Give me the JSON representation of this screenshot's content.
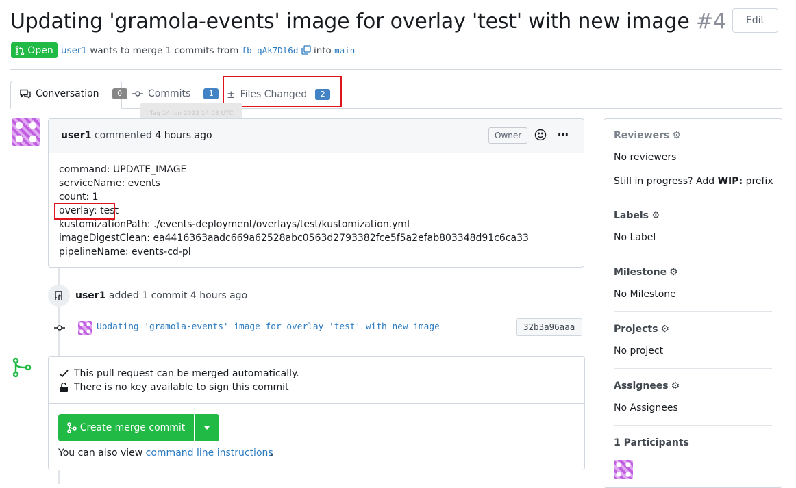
{
  "header": {
    "title": "Updating 'gramola-events' image for overlay 'test' with new image",
    "number": "#4",
    "edit_label": "Edit",
    "status": "Open",
    "author": "user1",
    "merge_text": "wants to merge 1 commits from",
    "head_branch": "fb-qAk7Dl6d",
    "into_text": "into",
    "base_branch": "main"
  },
  "tabs": [
    {
      "label": "Conversation",
      "count": "0"
    },
    {
      "label": "Commits",
      "count": "1"
    },
    {
      "label": "Files Changed",
      "count": "2"
    }
  ],
  "tooltip": "Tag 14 Jun 2023 14:03 UTC",
  "comment": {
    "author": "user1",
    "action": "commented",
    "time": "4 hours ago",
    "role": "Owner",
    "lines": [
      "command: UPDATE_IMAGE",
      "serviceName: events",
      "count: 1",
      "overlay: test",
      "kustomizationPath: ./events-deployment/overlays/test/kustomization.yml",
      "imageDigestClean: ea4416363aadc669a62528abc0563d2793382fce5f5a2efab803348d91c6ca33",
      "pipelineName: events-cd-pl"
    ]
  },
  "commit_event": {
    "author": "user1",
    "text": "added 1 commit 4 hours ago",
    "message": "Updating 'gramola-events' image for overlay 'test' with new image",
    "sha": "32b3a96aaa"
  },
  "merge": {
    "check1": "This pull request can be merged automatically.",
    "check2": "There is no key available to sign this commit",
    "button": "Create merge commit",
    "also_text": "You can also view",
    "link": "command line instructions",
    "period": "."
  },
  "sidebar": {
    "reviewers_title": "Reviewers",
    "reviewers_value": "No reviewers",
    "wip_prefix": "Still in progress? Add",
    "wip_bold": "WIP:",
    "wip_suffix": "prefix",
    "labels_title": "Labels",
    "labels_value": "No Label",
    "milestone_title": "Milestone",
    "milestone_value": "No Milestone",
    "projects_title": "Projects",
    "projects_value": "No project",
    "assignees_title": "Assignees",
    "assignees_value": "No Assignees",
    "participants_title": "1 Participants"
  },
  "colors": {
    "accent_green": "#21ba45",
    "link_blue": "#2a7ac0",
    "highlight_red": "#e0141d",
    "badge_blue": "#4183c4"
  }
}
